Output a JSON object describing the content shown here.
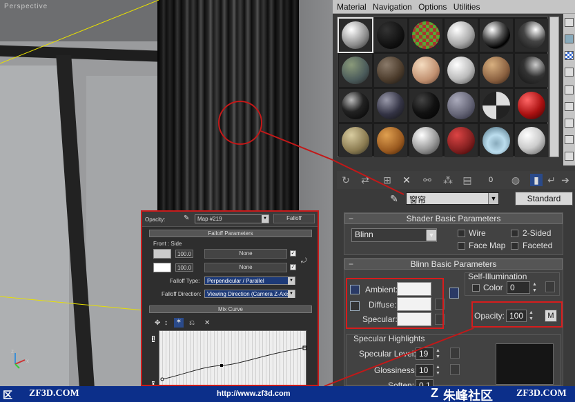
{
  "viewport": {
    "label": "Perspective",
    "axis_x": "x",
    "axis_z": "z"
  },
  "menu": [
    "Material",
    "Navigation",
    "Options",
    "Utilities"
  ],
  "material_editor": {
    "name": "窗帘",
    "type_button": "Standard",
    "icons": [
      "get-material-icon",
      "put-to-scene-icon",
      "assign-icon",
      "reset-icon",
      "make-copy-icon",
      "make-unique-icon",
      "put-to-library-icon",
      "material-id-icon",
      "show-map-icon",
      "show-end-result-icon",
      "go-to-parent-icon",
      "go-forward-icon",
      "pick-material-icon"
    ],
    "material_id_value": "0",
    "shader": {
      "title": "Shader Basic Parameters",
      "shader_type": "Blinn",
      "wire": "Wire",
      "two_sided": "2-Sided",
      "face_map": "Face Map",
      "faceted": "Faceted"
    },
    "blinn": {
      "title": "Blinn Basic Parameters",
      "self_illum_title": "Self-Illumination",
      "ambient": "Ambient:",
      "diffuse": "Diffuse:",
      "specular": "Specular:",
      "color_label": "Color",
      "color_value": "0",
      "opacity_label": "Opacity:",
      "opacity_value": "100",
      "map_button": "M"
    },
    "highlights": {
      "title": "Specular Highlights",
      "level_label": "Specular Level:",
      "level_value": "19",
      "gloss_label": "Glossiness:",
      "gloss_value": "10",
      "soften_label": "Soften:",
      "soften_value": "0.1"
    }
  },
  "falloff": {
    "opacity_label": "Opacity:",
    "map_name": "Map #219",
    "map_type": "Falloff",
    "params_title": "Falloff Parameters",
    "front_side": "Front : Side",
    "row1_value": "100.0",
    "row1_map": "None",
    "row2_value": "100.0",
    "row2_map": "None",
    "falloff_type_label": "Falloff Type:",
    "falloff_type_value": "Perpendicular / Parallel",
    "falloff_dir_label": "Falloff Direction:",
    "falloff_dir_value": "Viewing Direction (Camera Z-Axis)",
    "mix_curve_title": "Mix Curve",
    "graph_top": "1",
    "graph_bottom": "0"
  },
  "banner": {
    "left_char": "区",
    "left_site": "ZF3D.COM",
    "url": "http://www.zf3d.com",
    "center_brand": "朱峰社区",
    "right_site": "ZF3D.COM"
  },
  "colors": {
    "banner": "#0c2f8a",
    "highlight_red": "#d81c1c",
    "panel": "#3a3a3a",
    "name_dropdown": "#1d3a78"
  }
}
